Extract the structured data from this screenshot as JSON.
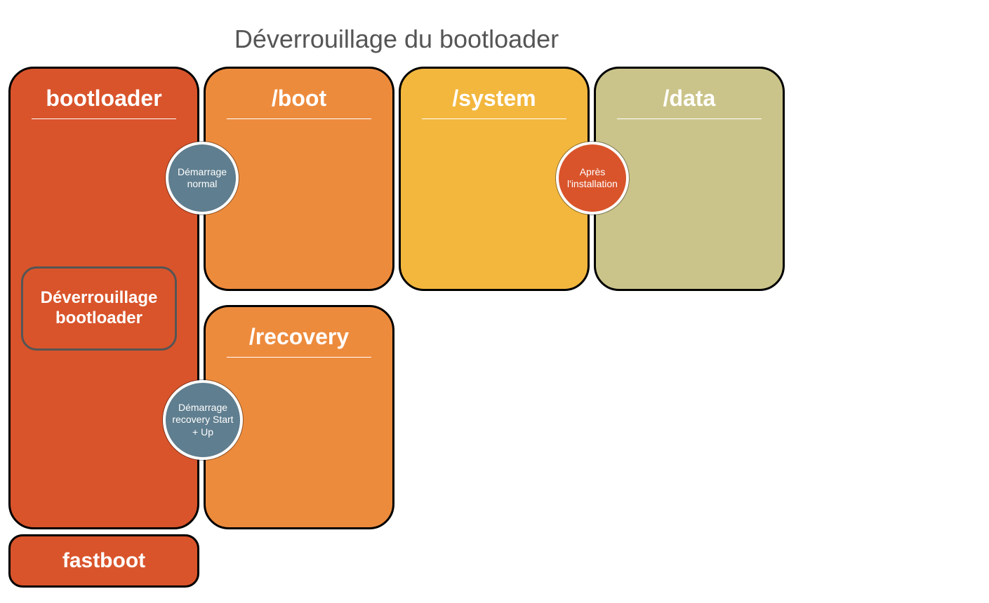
{
  "title": "Déverrouillage du bootloader",
  "boxes": {
    "bootloader": {
      "label": "bootloader",
      "color": "#d9542b"
    },
    "boot": {
      "label": "/boot",
      "color": "#ed8b3d"
    },
    "system": {
      "label": "/system",
      "color": "#f3b73e"
    },
    "data": {
      "label": "/data",
      "color": "#cbc48a"
    },
    "recovery": {
      "label": "/recovery",
      "color": "#ed8b3d"
    }
  },
  "innerBox": {
    "label": "Déverrouillage bootloader",
    "color": "#d9542b"
  },
  "fastboot": {
    "label": "fastboot",
    "color": "#d9542b"
  },
  "circles": {
    "normalBoot": {
      "label": "Démarrage normal",
      "color": "#5f7e8f"
    },
    "afterInstall": {
      "label": "Après l'installation",
      "color": "#d9542b"
    },
    "recoveryBoot": {
      "label": "Démarrage recovery Start + Up",
      "color": "#5f7e8f"
    }
  }
}
